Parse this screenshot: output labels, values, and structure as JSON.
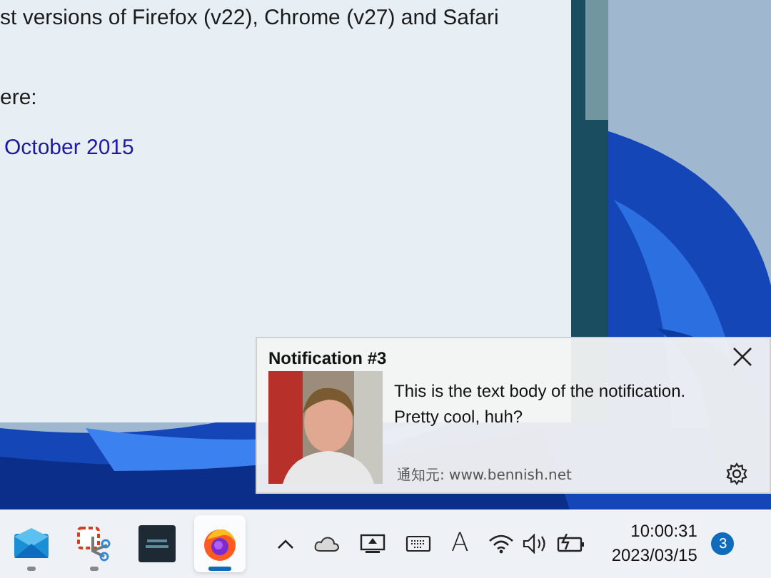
{
  "page": {
    "lines": [
      "st versions of Firefox (v22), Chrome (v27) and Safari",
      "ere:"
    ],
    "link": "October 2015"
  },
  "notification": {
    "title": "Notification #3",
    "body": [
      "This is the text body of the notification.",
      "Pretty cool, huh?"
    ],
    "source": "通知元: www.bennish.net"
  },
  "taskbar": {
    "apps": [
      {
        "kind": "mail",
        "running": true,
        "selected": false
      },
      {
        "kind": "snip",
        "running": true,
        "selected": false
      },
      {
        "kind": "dark",
        "running": false,
        "selected": false
      },
      {
        "kind": "firefox",
        "running": true,
        "selected": true
      }
    ],
    "ime": "A",
    "time": "10:00:31",
    "date": "2023/03/15",
    "badge": "3"
  }
}
